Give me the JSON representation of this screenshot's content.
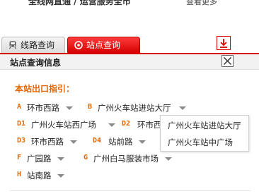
{
  "top_strip": {
    "cut_text": "全线网直通 / 运营服务全市",
    "more_link": "查看更多"
  },
  "tabs": [
    {
      "label": "线路查询",
      "icon": "train-icon",
      "active": false
    },
    {
      "label": "站点查询",
      "icon": "target-icon",
      "active": true
    }
  ],
  "toolbar": {
    "download_icon": "download-icon"
  },
  "panel": {
    "title": "站点查询信息",
    "close_icon": "close-icon"
  },
  "exits_heading": "本站出口指引：",
  "exits": [
    {
      "code": "A",
      "name": "环市西路"
    },
    {
      "code": "B",
      "name": "广州火车站进站大厅"
    },
    {
      "code": "D1",
      "name": "广州火车站西广场"
    },
    {
      "code": "D2",
      "name": "环市西路"
    },
    {
      "code": "D3",
      "name": "环市西路"
    },
    {
      "code": "D4",
      "name": "站前路"
    },
    {
      "code": "F",
      "name": "广园路"
    },
    {
      "code": "G",
      "name": "广州白马服装市场"
    },
    {
      "code": "H",
      "name": "站南路"
    }
  ],
  "popup": {
    "items": [
      "广州火车站进站大厅",
      "广州火车站中广场"
    ]
  },
  "colors": {
    "accent_red": "#d60000",
    "exit_code_orange": "#e06600",
    "panel_header_bg": "#f2f2f2"
  }
}
